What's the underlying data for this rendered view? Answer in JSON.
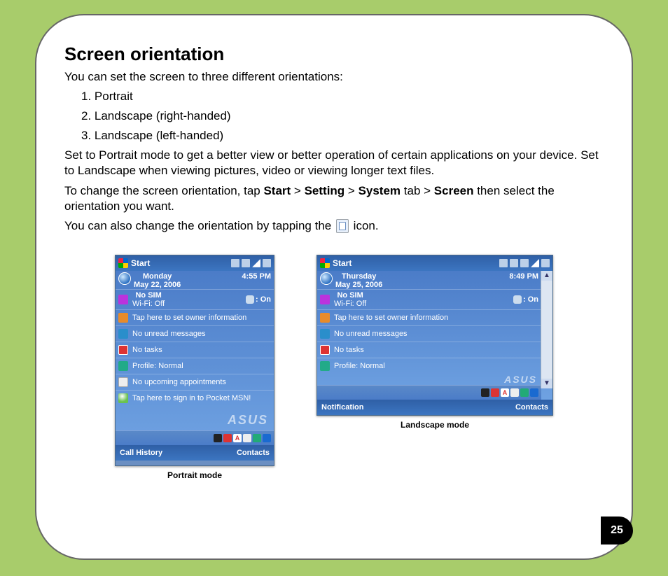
{
  "page_number": "25",
  "heading": "Screen orientation",
  "intro": "You can set the screen to three different orientations:",
  "list": {
    "i1": "1. Portrait",
    "i2": "2. Landscape (right-handed)",
    "i3": "3. Landscape (left-handed)"
  },
  "para_portrait_use": "Set to Portrait mode to get a better view or better operation of certain applications on your device. Set to Landscape when viewing pictures, video or viewing longer text files.",
  "instr": {
    "pre": "To change the screen orientation, tap ",
    "b1": "Start",
    "gt1": " > ",
    "b2": "Setting",
    "gt2": " > ",
    "b3": "System",
    "tab": " tab > ",
    "b4": "Screen",
    "post": " then select the orientation you want."
  },
  "tap_icon": {
    "pre": "You can also change the orientation by tapping the ",
    "post": " icon."
  },
  "captions": {
    "portrait": "Portrait mode",
    "landscape": "Landscape mode"
  },
  "device_common": {
    "start": "Start",
    "nosim": "No SIM",
    "wifi": "Wi-Fi: Off",
    "bt_on": ": On",
    "owner": "Tap here to set owner information",
    "mail": "No unread messages",
    "tasks": "No tasks",
    "profile": "Profile: Normal",
    "appts": "No upcoming appointments",
    "msn": "Tap here to sign in to Pocket MSN!",
    "asus": "ASUS",
    "soft_right": "Contacts"
  },
  "portrait_dev": {
    "day": "Monday",
    "date": "May 22, 2006",
    "time": "4:55 PM",
    "soft_left": "Call History"
  },
  "landscape_dev": {
    "day": "Thursday",
    "date": "May 25, 2006",
    "time": "8:49 PM",
    "soft_left": "Notification"
  }
}
